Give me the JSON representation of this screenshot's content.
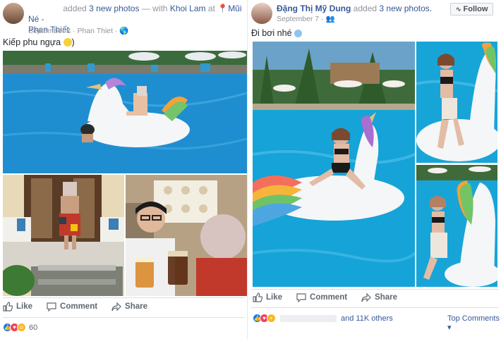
{
  "left": {
    "author_tail": "added",
    "photos_count": "3 new photos",
    "with_text": "— with",
    "with_name": "Khoi Lam",
    "at_text": "at",
    "place": "Mũi Né -",
    "place2": "Phan Thiết",
    "date": "September 2 · Phan Thiet ·",
    "caption": "Kiếp phu ngựa",
    "like": "Like",
    "comment": "Comment",
    "share": "Share",
    "reaction_count": "60"
  },
  "right": {
    "author": "Đặng Thị Mỹ Dung",
    "added": "added",
    "photos_count": "3 new photos.",
    "date": "September 7 ·",
    "caption": "Đi bơi nhé",
    "follow": "Follow",
    "like": "Like",
    "comment": "Comment",
    "share": "Share",
    "others": "and 11K others",
    "top_comments": "Top Comments ▾"
  },
  "colors": {
    "link": "#365899",
    "pool": "#1c8fd6",
    "like_blue": "#1877f2",
    "love_red": "#f33e58",
    "haha_yellow": "#f7b928"
  }
}
